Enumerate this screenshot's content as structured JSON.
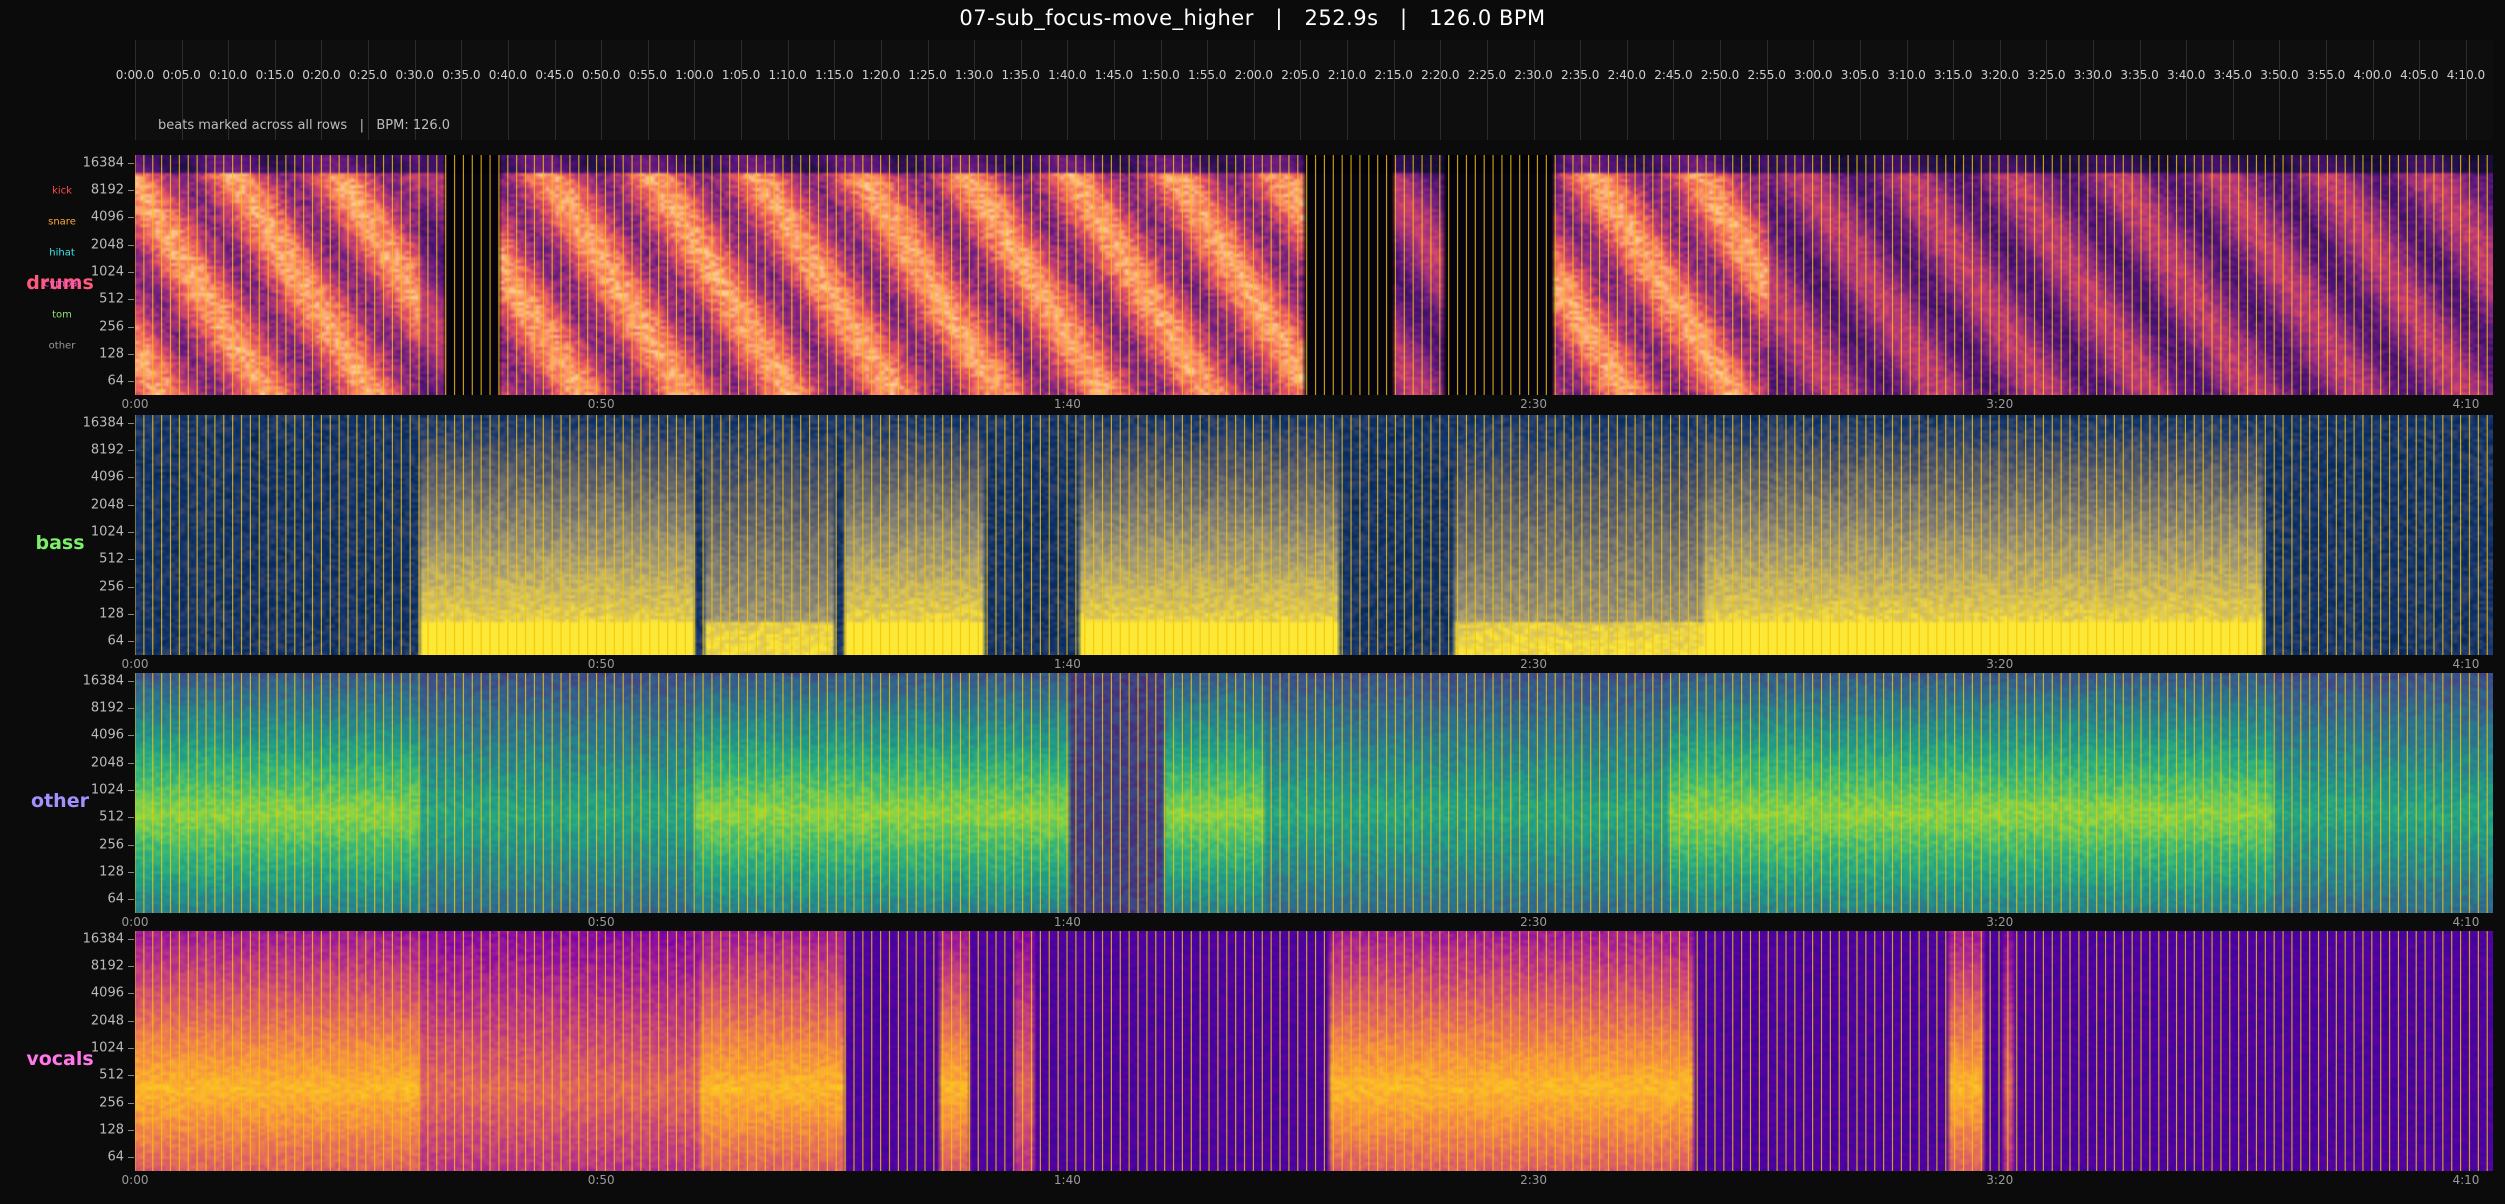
{
  "title": "07-sub_focus-move_higher   |   252.9s   |   126.0 BPM",
  "timeline": {
    "labels": [
      "0:00.0",
      "0:05.0",
      "0:10.0",
      "0:15.0",
      "0:20.0",
      "0:25.0",
      "0:30.0",
      "0:35.0",
      "0:40.0",
      "0:45.0",
      "0:50.0",
      "0:55.0",
      "1:00.0",
      "1:05.0",
      "1:10.0",
      "1:15.0",
      "1:20.0",
      "1:25.0",
      "1:30.0",
      "1:35.0",
      "1:40.0",
      "1:45.0",
      "1:50.0",
      "1:55.0",
      "2:00.0",
      "2:05.0",
      "2:10.0",
      "2:15.0",
      "2:20.0",
      "2:25.0",
      "2:30.0",
      "2:35.0",
      "2:40.0",
      "2:45.0",
      "2:50.0",
      "2:55.0",
      "3:00.0",
      "3:05.0",
      "3:10.0",
      "3:15.0",
      "3:20.0",
      "3:25.0",
      "3:30.0",
      "3:35.0",
      "3:40.0",
      "3:45.0",
      "3:50.0",
      "3:55.0",
      "4:00.0",
      "4:05.0",
      "4:10.0"
    ],
    "note": "beats marked across all rows   |   BPM: 126.0"
  },
  "chart_data": {
    "type": "heatmap",
    "title": "07-sub_focus-move_higher   |   252.9s   |   126.0 BPM",
    "duration_s": 252.9,
    "bpm": 126.0,
    "beat_interval_s": 0.476,
    "x_axis": {
      "ticks_s": [
        0,
        50,
        100,
        150,
        200,
        250
      ],
      "labels": [
        "0:00",
        "0:50",
        "1:40",
        "2:30",
        "3:20",
        "4:10"
      ],
      "range_s": [
        0,
        252.9
      ]
    },
    "y_axis": {
      "scale": "log2",
      "ticks_hz": [
        64,
        128,
        256,
        512,
        1024,
        2048,
        4096,
        8192,
        16384
      ],
      "labels": [
        "64",
        "128",
        "256",
        "512",
        "1024",
        "2048",
        "4096",
        "8192",
        "16384"
      ],
      "range_hz": [
        45,
        20000
      ]
    },
    "beat_line_color": "#f5c400",
    "rows": [
      {
        "name": "drums",
        "label_color": "#ff5a7a",
        "colormap": "magma",
        "legend": [
          {
            "label": "kick",
            "color": "#ff4b4b"
          },
          {
            "label": "snare",
            "color": "#ffa63a"
          },
          {
            "label": "hihat",
            "color": "#3ee4e4"
          },
          {
            "label": "cymbal",
            "color": "#ff58d5"
          },
          {
            "label": "tom",
            "color": "#8fe27b"
          },
          {
            "label": "other",
            "color": "#9a9a9a"
          }
        ],
        "active_ranges_s": [
          [
            0,
            30.5
          ],
          [
            30.5,
            33
          ],
          [
            39,
            62
          ],
          [
            62,
            125
          ],
          [
            135,
            140
          ],
          [
            152,
            168
          ],
          [
            168,
            175
          ],
          [
            175,
            252.9
          ]
        ]
      },
      {
        "name": "bass",
        "label_color": "#7cef6a",
        "colormap": "cividis",
        "active_ranges_s": [
          [
            30.5,
            60
          ],
          [
            61,
            75
          ],
          [
            76,
            91
          ],
          [
            101,
            129
          ],
          [
            141,
            168
          ],
          [
            168,
            197
          ],
          [
            197,
            228
          ]
        ]
      },
      {
        "name": "other",
        "label_color": "#a590ff",
        "colormap": "viridis",
        "active_ranges_s": [
          [
            0,
            30.5
          ],
          [
            30.5,
            60
          ],
          [
            60,
            100
          ],
          [
            110,
            121
          ],
          [
            121,
            164
          ],
          [
            164,
            182
          ],
          [
            182,
            229
          ],
          [
            229,
            252.9
          ]
        ]
      },
      {
        "name": "vocals",
        "label_color": "#ff77e8",
        "colormap": "plasma",
        "active_ranges_s": [
          [
            0,
            30.5
          ],
          [
            30.5,
            60.5
          ],
          [
            60.5,
            76
          ],
          [
            86,
            89
          ],
          [
            94,
            96
          ],
          [
            128,
            167
          ],
          [
            194,
            198
          ],
          [
            200,
            201
          ]
        ]
      }
    ]
  }
}
